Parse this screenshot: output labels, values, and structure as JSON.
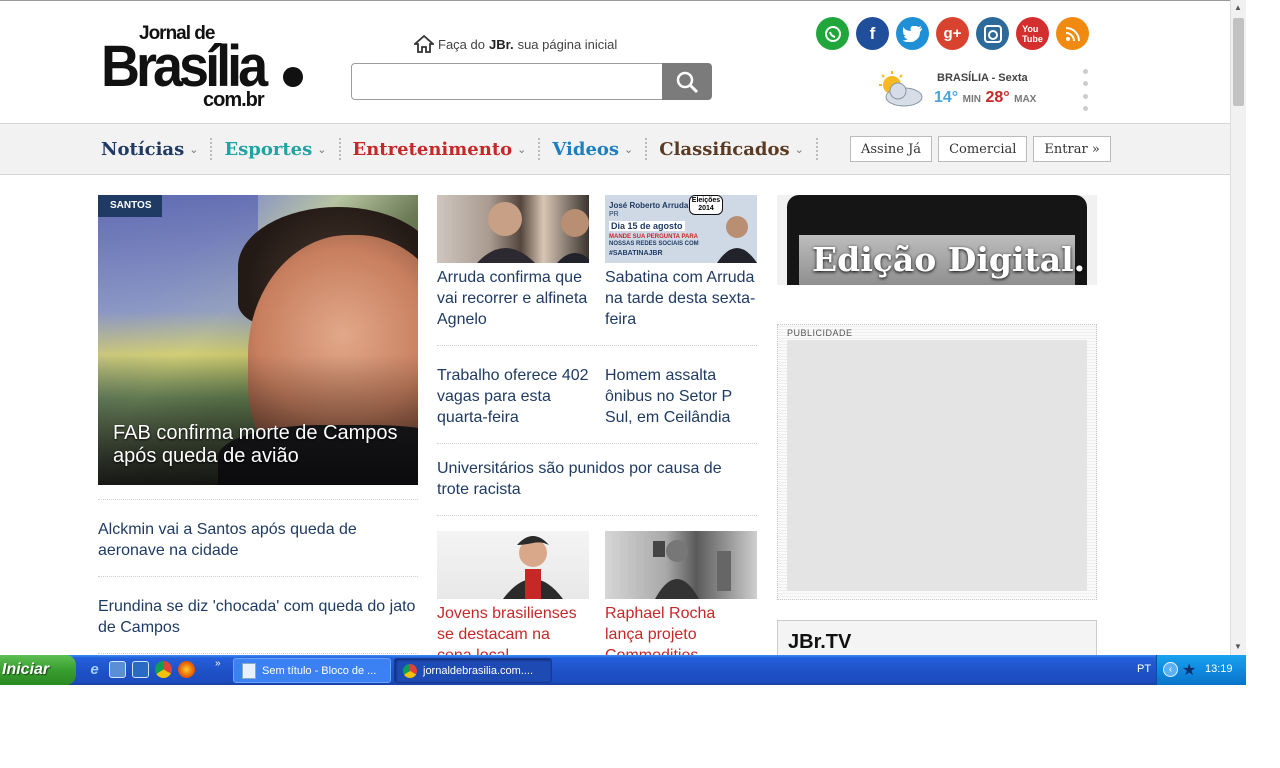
{
  "header": {
    "logo": {
      "line1": "Jornal de",
      "line2": "Brasília",
      "line3": "com.br"
    },
    "homepage_tip": {
      "prefix": "Faça do ",
      "brand": "JBr.",
      "suffix": " sua página inicial"
    },
    "search": {
      "placeholder": ""
    },
    "social_icons": [
      "whatsapp-icon",
      "facebook-icon",
      "twitter-icon",
      "google-plus-icon",
      "instagram-icon",
      "youtube-icon",
      "rss-icon"
    ],
    "weather": {
      "city": "BRASÍLIA - Sexta",
      "min": "14°",
      "min_label": "MIN",
      "max": "28°",
      "max_label": "MAX"
    }
  },
  "nav": {
    "items": [
      {
        "label": "Notícias",
        "color": "#1f3b63"
      },
      {
        "label": "Esportes",
        "color": "#21a3a3"
      },
      {
        "label": "Entretenimento",
        "color": "#c62828"
      },
      {
        "label": "Videos",
        "color": "#1e7fc0"
      },
      {
        "label": "Classificados",
        "color": "#5a3a22"
      }
    ],
    "buttons": [
      "Assine Já",
      "Comercial",
      "Entrar »"
    ]
  },
  "feature": {
    "tag": "SANTOS",
    "headline": "FAB confirma morte de Campos após queda de avião"
  },
  "left_stories": [
    "Alckmin vai a Santos após queda de aeronave na cidade",
    "Erundina se diz 'chocada' com queda do jato de Campos"
  ],
  "center": {
    "top_story_a": "Arruda confirma que vai recorrer e alfineta Agnelo",
    "top_story_b": "Sabatina com Arruda na tarde desta sexta-feira",
    "sabatina_thumb": {
      "name": "José Roberto Arruda",
      "party": "PR",
      "badge": "Eleições 2014",
      "date": "Dia 15 de agosto",
      "line2": "MANDE SUA PERGUNTA PARA",
      "line3": "NOSSAS REDES SOCIAIS COM",
      "hashtag": "#SABATINAJBR"
    },
    "mid_story_a": "Trabalho oferece 402 vagas para esta quarta-feira",
    "mid_story_b": "Homem assalta ônibus no Setor P Sul, em Ceilândia",
    "wide_story": "Universitários são punidos por causa de trote racista",
    "bottom_story_a": "Jovens brasilienses se destacam na cena local",
    "bottom_story_b": "Raphael Rocha lança projeto Commodities"
  },
  "sidebar": {
    "digital_edition": "Edição Digital.",
    "ad_label": "PUBLICIDADE",
    "tv_logo": "JBr.TV"
  },
  "taskbar": {
    "start": "Iniciar",
    "tasks": [
      "Sem título - Bloco de ...",
      "jornaldebrasilia.com...."
    ],
    "language": "PT",
    "clock": "13:19"
  }
}
